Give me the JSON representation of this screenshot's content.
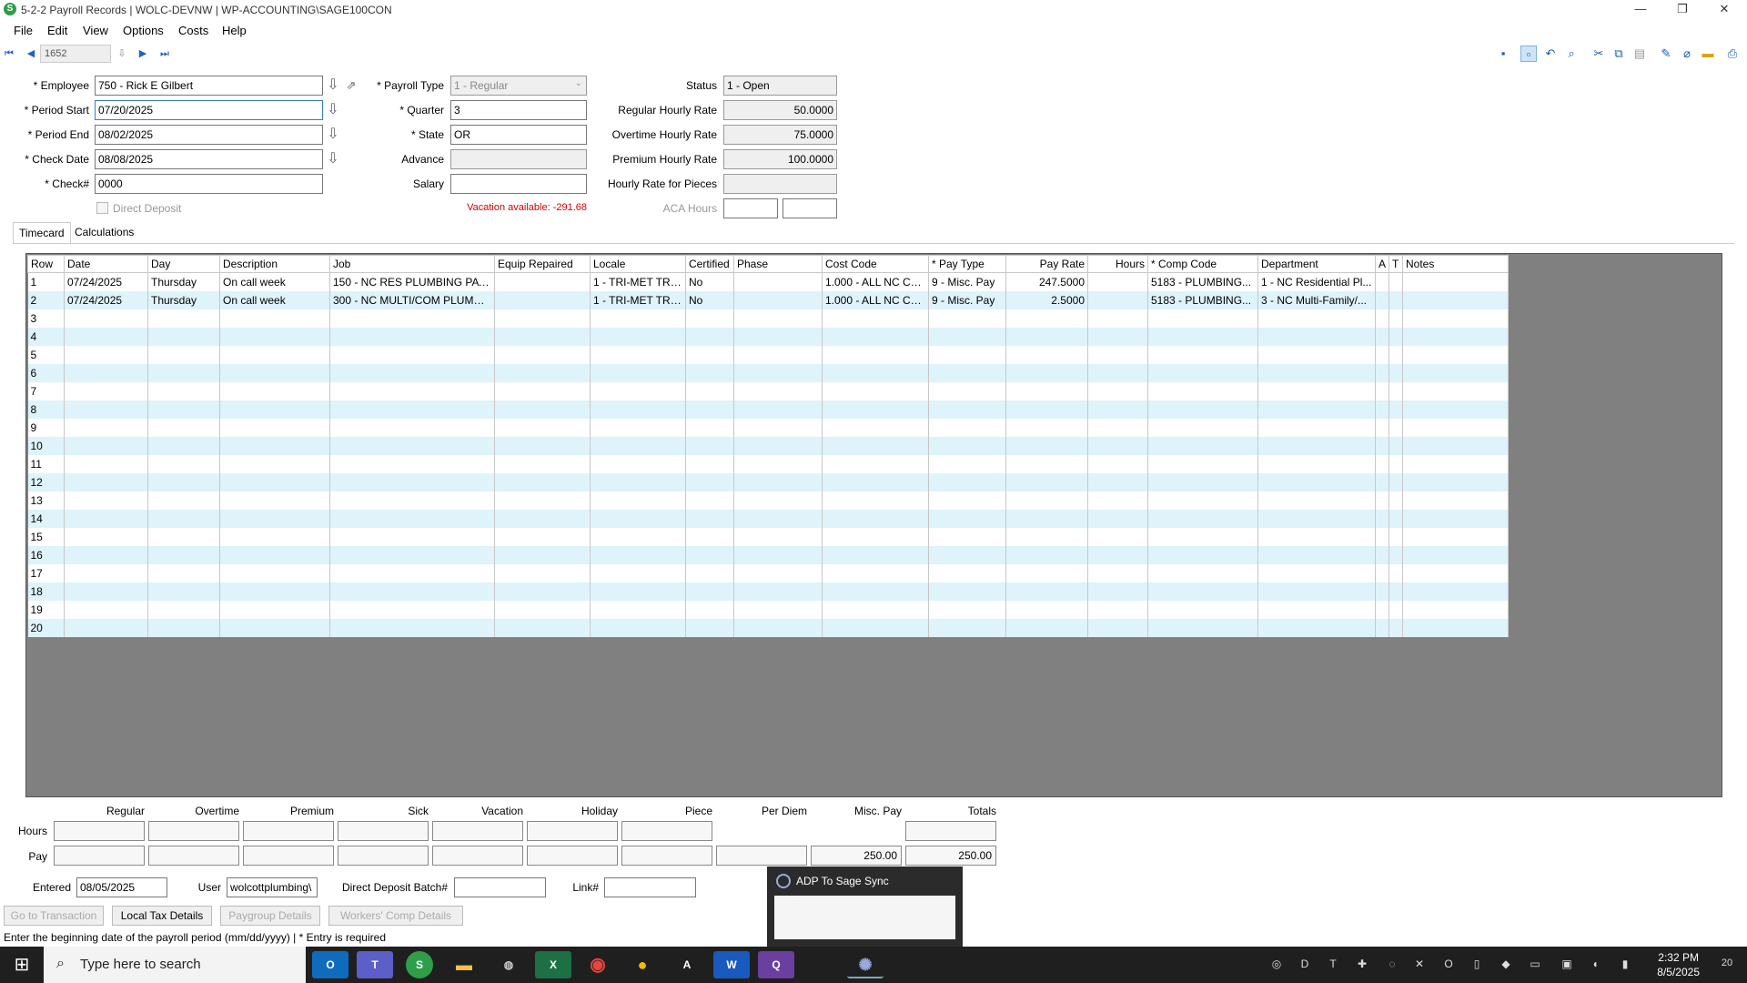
{
  "window": {
    "title": "5-2-2 Payroll Records  |  WOLC-DEVNW  |  WP-ACCOUNTING\\SAGE100CON",
    "minimize": "—",
    "restore": "❐",
    "close": "✕"
  },
  "menu": [
    "File",
    "Edit",
    "View",
    "Options",
    "Costs",
    "Help"
  ],
  "nav": {
    "record": "1652"
  },
  "form": {
    "employee_label": "* Employee",
    "employee": "750 - Rick E Gilbert",
    "period_start_label": "* Period Start",
    "period_start": "07/20/2025",
    "period_end_label": "* Period End",
    "period_end": "08/02/2025",
    "check_date_label": "* Check Date",
    "check_date": "08/08/2025",
    "check_no_label": "* Check#",
    "check_no": "0000",
    "direct_deposit_label": "Direct Deposit",
    "payroll_type_label": "* Payroll Type",
    "payroll_type": "1 - Regular",
    "quarter_label": "* Quarter",
    "quarter": "3",
    "state_label": "* State",
    "state": "OR",
    "advance_label": "Advance",
    "advance": "",
    "salary_label": "Salary",
    "salary": "",
    "vacation_available": "Vacation available:  -291.68",
    "status_label": "Status",
    "status": "1 - Open",
    "regular_rate_label": "Regular Hourly Rate",
    "regular_rate": "50.0000",
    "overtime_rate_label": "Overtime Hourly Rate",
    "overtime_rate": "75.0000",
    "premium_rate_label": "Premium Hourly Rate",
    "premium_rate": "100.0000",
    "pieces_rate_label": "Hourly Rate for Pieces",
    "pieces_rate": "",
    "aca_hours_label": "ACA Hours"
  },
  "tabs": [
    "Timecard",
    "Calculations"
  ],
  "grid": {
    "columns": [
      "Row",
      "Date",
      "Day",
      "Description",
      "Job",
      "Equip Repaired",
      "Locale",
      "Certified",
      "Phase",
      "Cost Code",
      "* Pay Type",
      "Pay Rate",
      "Hours",
      "* Comp Code",
      "Department",
      "A",
      "T",
      "Notes"
    ],
    "rows": [
      [
        "1",
        "07/24/2025",
        "Thursday",
        "On call week",
        "150 - NC RES PLUMBING PAYR...",
        "",
        "1 - TRI-MET TRA...",
        "No",
        "",
        "1.000 - ALL NC CO...",
        "9 - Misc. Pay",
        "247.5000",
        "",
        "5183 - PLUMBING...",
        "1 - NC Residential Pl...",
        "",
        "",
        ""
      ],
      [
        "2",
        "07/24/2025",
        "Thursday",
        "On call week",
        "300 - NC MULTI/COM PLUMBI...",
        "",
        "1 - TRI-MET TRA...",
        "No",
        "",
        "1.000 - ALL NC CO...",
        "9 - Misc. Pay",
        "2.5000",
        "",
        "5183 - PLUMBING...",
        "3 - NC Multi-Family/...",
        "",
        "",
        ""
      ],
      [
        "3"
      ],
      [
        "4"
      ],
      [
        "5"
      ],
      [
        "6"
      ],
      [
        "7"
      ],
      [
        "8"
      ],
      [
        "9"
      ],
      [
        "10"
      ],
      [
        "11"
      ],
      [
        "12"
      ],
      [
        "13"
      ],
      [
        "14"
      ],
      [
        "15"
      ],
      [
        "16"
      ],
      [
        "17"
      ],
      [
        "18"
      ],
      [
        "19"
      ],
      [
        "20"
      ]
    ]
  },
  "totals": {
    "headers": [
      "Regular",
      "Overtime",
      "Premium",
      "Sick",
      "Vacation",
      "Holiday",
      "Piece",
      "Per Diem",
      "Misc. Pay",
      "Totals"
    ],
    "hours_label": "Hours",
    "pay_label": "Pay",
    "misc_pay": "250.00",
    "total_pay": "250.00"
  },
  "footer": {
    "entered_label": "Entered",
    "entered": "08/05/2025",
    "user_label": "User",
    "user": "wolcottplumbing\\",
    "dd_batch_label": "Direct Deposit Batch#",
    "dd_batch": "",
    "link_label": "Link#",
    "link": "",
    "btn_goto": "Go to Transaction",
    "btn_local_tax": "Local Tax Details",
    "btn_paygroup": "Paygroup Details",
    "btn_workers_comp": "Workers' Comp Details",
    "status_text": "Enter the beginning date of the payroll period (mm/dd/yyyy)  |  * Entry is required"
  },
  "popup": {
    "title": "ADP To Sage Sync"
  },
  "taskbar": {
    "search_placeholder": "Type here to search",
    "time": "2:32 PM",
    "date": "8/5/2025",
    "notifications": "20"
  },
  "colors": {
    "accent": "#2461c2",
    "grid_alt_row": "#def3fa",
    "grid_bg": "#808080",
    "vacation_text": "#d00000"
  }
}
